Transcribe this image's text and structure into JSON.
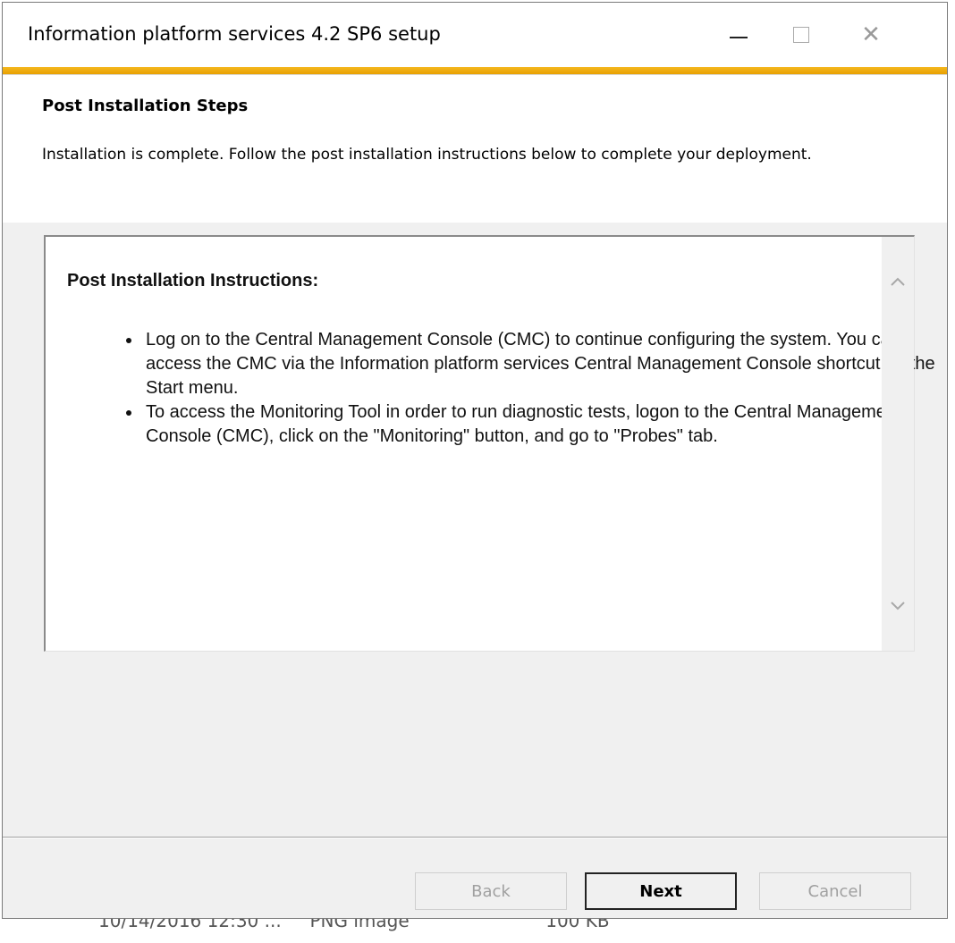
{
  "window": {
    "title": "Information platform services 4.2 SP6 setup",
    "controls": {
      "minimize_icon": "minimize-icon",
      "maximize_icon": "maximize-icon",
      "close_icon": "close-icon"
    },
    "accent_color": "#f0a800"
  },
  "header": {
    "title": "Post Installation Steps",
    "description": "Installation is complete. Follow the post installation instructions below to complete your deployment."
  },
  "instructions": {
    "title": "Post Installation Instructions:",
    "items": [
      "Log on to the Central Management Console (CMC) to continue configuring the system. You can access the CMC via the Information platform services Central Management Console shortcut on the Start menu.",
      "To access the Monitoring Tool in order to run diagnostic tests, logon to the Central Management Console (CMC), click on the \"Monitoring\" button, and go to \"Probes\" tab."
    ]
  },
  "buttons": {
    "back": "Back",
    "next": "Next",
    "cancel": "Cancel"
  },
  "background_window": {
    "partial_text": "10/14/2016 12:30 ...     PNG image                        100 KB"
  }
}
